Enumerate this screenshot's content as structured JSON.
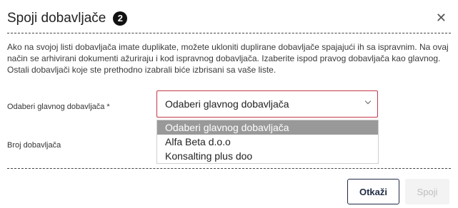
{
  "dialog": {
    "title": "Spoji dobavljače",
    "badge": "2",
    "close_icon": "close-icon",
    "description": "Ako na svojoj listi dobavljača imate duplikate, možete ukloniti duplirane dobavljače spajajući ih sa ispravnim. Na ovaj način se arhivirani dokumenti ažuriraju i kod ispravnog dobavljača. Izaberite ispod pravog dobavljača kao glavnog. Ostali dobavljači koje ste prethodno izabrali biće izbrisani sa vaše liste."
  },
  "form": {
    "main_supplier_label": "Odaberi glavnog dobavljača *",
    "supplier_count_label": "Broj dobavljača",
    "select": {
      "value": "Odaberi glavnog dobavljača",
      "icon": "chevron-down-icon",
      "border_color": "#c2364a"
    },
    "options": [
      "Odaberi glavnog dobavljača",
      "Alfa Beta d.o.o",
      "Konsalting plus doo"
    ]
  },
  "footer": {
    "cancel_label": "Otkaži",
    "merge_label": "Spoji"
  }
}
